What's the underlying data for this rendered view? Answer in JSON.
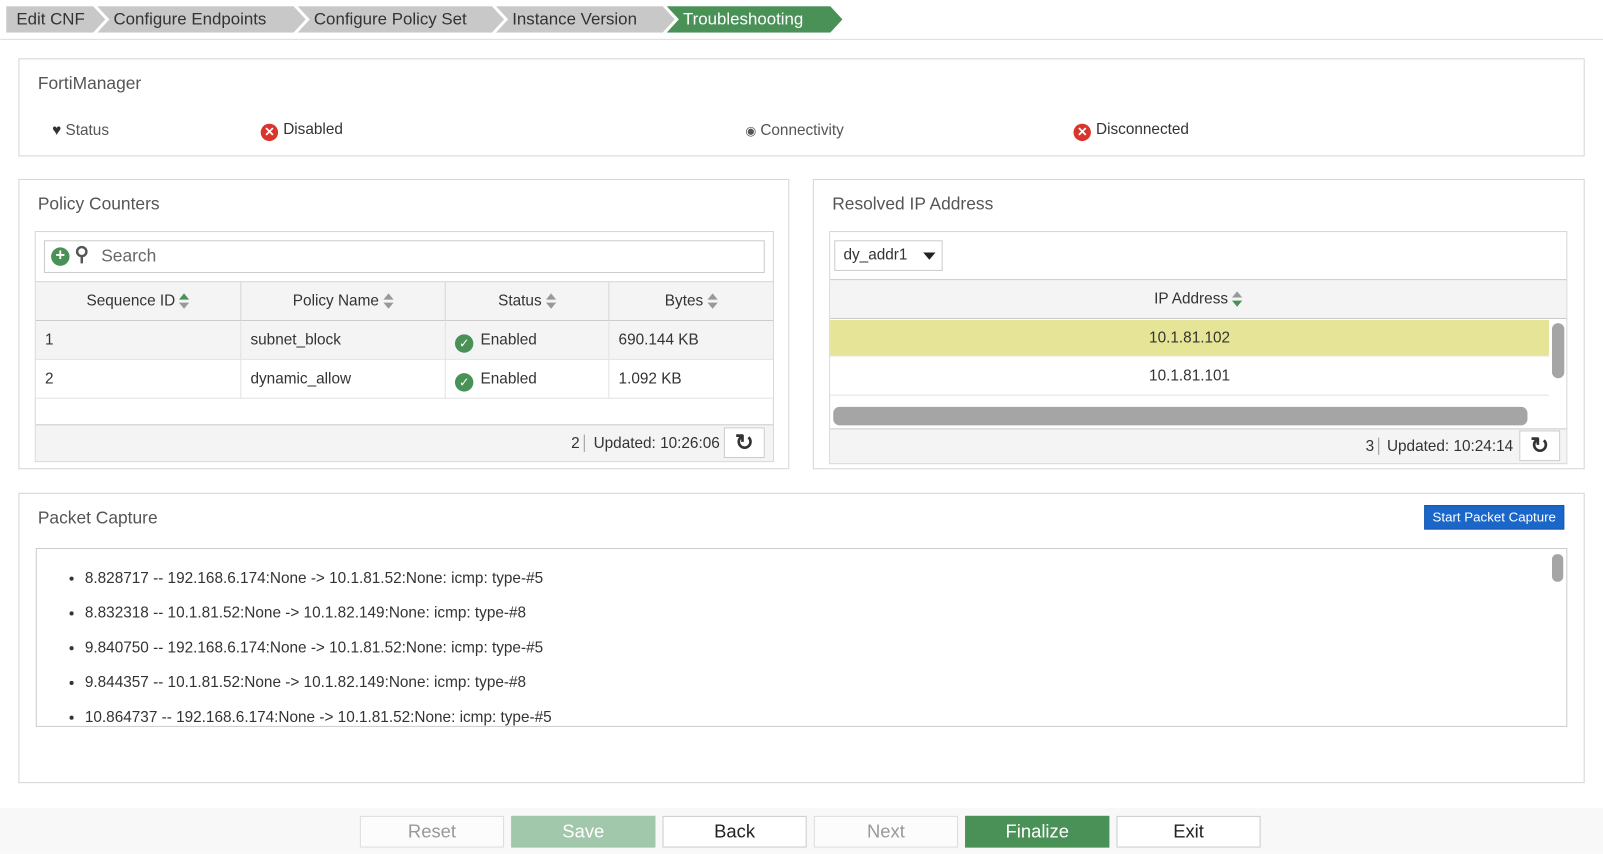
{
  "breadcrumb": [
    "Edit CNF",
    "Configure Endpoints",
    "Configure Policy Set",
    "Instance Version",
    "Troubleshooting"
  ],
  "fortimanager": {
    "title": "FortiManager",
    "status_label": "Status",
    "status_value": "Disabled",
    "connectivity_label": "Connectivity",
    "connectivity_value": "Disconnected"
  },
  "policy_counters": {
    "title": "Policy Counters",
    "search_placeholder": "Search",
    "columns": [
      "Sequence ID",
      "Policy Name",
      "Status",
      "Bytes"
    ],
    "rows": [
      {
        "id": "1",
        "name": "subnet_block",
        "status": "Enabled",
        "bytes": "690.144 KB"
      },
      {
        "id": "2",
        "name": "dynamic_allow",
        "status": "Enabled",
        "bytes": "1.092 KB"
      }
    ],
    "count": "2",
    "updated": "Updated: 10:26:06"
  },
  "resolved_ip": {
    "title": "Resolved IP Address",
    "selected": "dy_addr1",
    "column": "IP Address",
    "rows": [
      "10.1.81.102",
      "10.1.81.101"
    ],
    "count": "3",
    "updated": "Updated: 10:24:14"
  },
  "packet_capture": {
    "title": "Packet Capture",
    "button": "Start Packet Capture",
    "items": [
      "8.828717 -- 192.168.6.174:None -> 10.1.81.52:None: icmp: type-#5",
      "8.832318 -- 10.1.81.52:None -> 10.1.82.149:None: icmp: type-#8",
      "9.840750 -- 192.168.6.174:None -> 10.1.81.52:None: icmp: type-#5",
      "9.844357 -- 10.1.81.52:None -> 10.1.82.149:None: icmp: type-#8",
      "10.864737 -- 192.168.6.174:None -> 10.1.81.52:None: icmp: type-#5"
    ]
  },
  "footer": {
    "reset": "Reset",
    "save": "Save",
    "back": "Back",
    "next": "Next",
    "finalize": "Finalize",
    "exit": "Exit"
  },
  "colors": {
    "accent": "#4a9157",
    "error": "#d9352d",
    "highlight": "#e6e497",
    "primary": "#1a66c9"
  }
}
